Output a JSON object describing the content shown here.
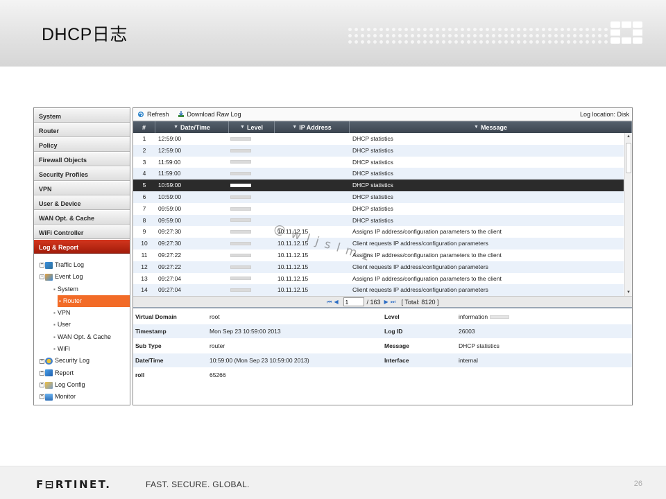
{
  "slide": {
    "title": "DHCP日志",
    "footer_logo": "F⊟RTINET.",
    "footer_tagline": "FAST. SECURE. GLOBAL.",
    "page_number": "26",
    "watermark": "@wljslmz"
  },
  "nav": {
    "items": [
      "System",
      "Router",
      "Policy",
      "Firewall Objects",
      "Security Profiles",
      "VPN",
      "User & Device",
      "WAN Opt. & Cache",
      "WiFi Controller",
      "Log & Report"
    ],
    "active": "Log & Report",
    "tree": {
      "traffic_log": "Traffic Log",
      "event_log": "Event Log",
      "event_children": [
        "System",
        "Router",
        "VPN",
        "User",
        "WAN Opt. & Cache",
        "WiFi"
      ],
      "selected_child": "Router",
      "security_log": "Security Log",
      "report": "Report",
      "log_config": "Log Config",
      "monitor": "Monitor"
    }
  },
  "toolbar": {
    "refresh_label": "Refresh",
    "download_label": "Download Raw Log",
    "log_location": "Log location: Disk"
  },
  "grid": {
    "columns": [
      "#",
      "Date/Time",
      "Level",
      "IP Address",
      "Message"
    ],
    "selected_row": 5,
    "rows": [
      {
        "n": "1",
        "time": "12:59:00",
        "ip": "",
        "msg": "DHCP statistics"
      },
      {
        "n": "2",
        "time": "12:59:00",
        "ip": "",
        "msg": "DHCP statistics"
      },
      {
        "n": "3",
        "time": "11:59:00",
        "ip": "",
        "msg": "DHCP statistics"
      },
      {
        "n": "4",
        "time": "11:59:00",
        "ip": "",
        "msg": "DHCP statistics"
      },
      {
        "n": "5",
        "time": "10:59:00",
        "ip": "",
        "msg": "DHCP statistics"
      },
      {
        "n": "6",
        "time": "10:59:00",
        "ip": "",
        "msg": "DHCP statistics"
      },
      {
        "n": "7",
        "time": "09:59:00",
        "ip": "",
        "msg": "DHCP statistics"
      },
      {
        "n": "8",
        "time": "09:59:00",
        "ip": "",
        "msg": "DHCP statistics"
      },
      {
        "n": "9",
        "time": "09:27:30",
        "ip": "10.11.12.15",
        "msg": "Assigns IP address/configuration parameters to the client"
      },
      {
        "n": "10",
        "time": "09:27:30",
        "ip": "10.11.12.15",
        "msg": "Client requests IP address/configuration parameters"
      },
      {
        "n": "11",
        "time": "09:27:22",
        "ip": "10.11.12.15",
        "msg": "Assigns IP address/configuration parameters to the client"
      },
      {
        "n": "12",
        "time": "09:27:22",
        "ip": "10.11.12.15",
        "msg": "Client requests IP address/configuration parameters"
      },
      {
        "n": "13",
        "time": "09:27:04",
        "ip": "10.11.12.15",
        "msg": "Assigns IP address/configuration parameters to the client"
      },
      {
        "n": "14",
        "time": "09:27:04",
        "ip": "10.11.12.15",
        "msg": "Client requests IP address/configuration parameters"
      }
    ]
  },
  "pager": {
    "page_value": "1",
    "total_pages": "/ 163",
    "total": "[ Total: 8120 ]"
  },
  "details": {
    "rows": [
      {
        "k1": "Virtual Domain",
        "v1": "root",
        "k2": "Level",
        "v2": "information"
      },
      {
        "k1": "Timestamp",
        "v1": "Mon Sep 23 10:59:00 2013",
        "k2": "Log ID",
        "v2": "26003"
      },
      {
        "k1": "Sub Type",
        "v1": "router",
        "k2": "Message",
        "v2": "DHCP statistics"
      },
      {
        "k1": "Date/Time",
        "v1": "10:59:00 (Mon Sep 23 10:59:00 2013)",
        "k2": "Interface",
        "v2": "internal"
      },
      {
        "k1": "roll",
        "v1": "65266",
        "k2": "",
        "v2": ""
      }
    ]
  }
}
